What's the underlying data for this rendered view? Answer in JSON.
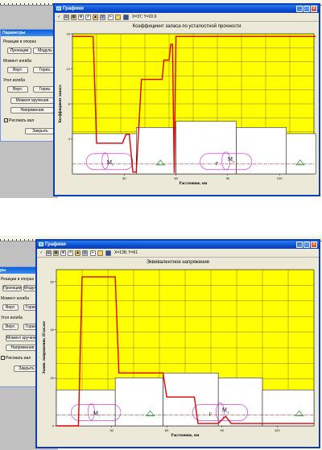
{
  "sidebar_a": {
    "panel_title": "Параметры",
    "group_reactions": "Реакции в опорах",
    "btn_projections": "Проекции",
    "btn_modulus": "Модуль",
    "group_bending_moment": "Момент изгиба",
    "btn_vert": "Верт.",
    "btn_horiz": "Гориз.",
    "group_deflection": "Угол изгиба",
    "btn_torque": "Момент кручения",
    "btn_stress": "Напряжения",
    "checkbox_draw_shaft": "Рисовать вал",
    "btn_close": "Закрыть"
  },
  "sidebar_b": {
    "panel_title": "Параметры",
    "group_reactions": "Реакции в опорах",
    "btn_projections": "Проекции",
    "btn_modulus": "Модуль",
    "group_bending_moment": "Момент изгиба",
    "btn_vert": "Верт.",
    "btn_horiz": "Гориз.",
    "group_deflection": "Угол изгиба",
    "btn_torque": "Момент кручения",
    "btn_stress": "Напряжения",
    "checkbox_draw_shaft": "Рисовать вал",
    "btn_close": "Закрыть"
  },
  "window_a": {
    "title": "Графики",
    "coords": "X=37; Y=20.6",
    "font_button": "F",
    "chart_title": "Коэффициент запаса по усталостной прочности"
  },
  "window_b": {
    "title": "Графики",
    "coords": "X=138; Y=61",
    "font_button": "F",
    "chart_title": "Эквивалентное напряжение"
  },
  "colors": {
    "plot_bg": "#ffff00",
    "curve": "#e00000",
    "shaft_outline": "#000000",
    "annotation": "#d020d0",
    "support": "#2a9a2a"
  },
  "icons": [
    "check-icon",
    "print-icon",
    "save-icon",
    "zoom-icon",
    "grid-icon",
    "chart-icon",
    "axes-icon",
    "font-icon",
    "folder-icon",
    "disk-icon"
  ],
  "chart_data": [
    {
      "type": "line",
      "title": "Коэффициент запаса по усталостной прочности",
      "xlabel": "Расстояние, мм",
      "ylabel": "Коэффициент запаса",
      "xlim": [
        0,
        140
      ],
      "ylim": [
        0,
        16
      ],
      "x_ticks": [
        30,
        60,
        90,
        120
      ],
      "y_ticks": [
        4,
        8,
        12,
        16
      ],
      "tick_labels": {
        "x": [
          "30",
          "60",
          "90",
          "120"
        ],
        "y": [
          "4",
          "8",
          "12",
          "16"
        ]
      },
      "grid": true,
      "series": [
        {
          "x": [
            0,
            12,
            14,
            16,
            20,
            29,
            31,
            33,
            35,
            37,
            40,
            41,
            52,
            53,
            56,
            57,
            58,
            59,
            60,
            141
          ],
          "y": [
            15.7,
            15.7,
            3.5,
            3.5,
            3.5,
            3.5,
            4.5,
            4.5,
            0.2,
            0.2,
            10.8,
            10.8,
            10.8,
            13.0,
            13.0,
            14.8,
            14.8,
            0.1,
            15.7,
            15.7
          ]
        }
      ],
      "annotations": [
        "M",
        "t",
        "F",
        "M",
        "a"
      ]
    },
    {
      "type": "line",
      "title": "Эквивалентное напряжение",
      "xlabel": "Расстояние, мм",
      "ylabel": "Эквив. напряжение, Н/кв.мм",
      "xlim": [
        0,
        140
      ],
      "ylim": [
        0,
        65
      ],
      "x_ticks": [
        30,
        60,
        90,
        120
      ],
      "y_ticks": [
        0,
        20,
        40,
        60
      ],
      "tick_labels": {
        "x": [
          "30",
          "60",
          "90",
          "120"
        ],
        "y": [
          "0",
          "20",
          "40",
          "60"
        ]
      },
      "grid": true,
      "series": [
        {
          "x": [
            0,
            12,
            14,
            32,
            34,
            58,
            60,
            75,
            77,
            88,
            92,
            95,
            140
          ],
          "y": [
            0,
            0,
            62,
            62,
            22,
            22,
            12,
            12,
            1,
            1,
            4,
            1,
            1
          ]
        }
      ],
      "annotations": [
        "M",
        "t",
        "F",
        "M",
        "a"
      ]
    }
  ]
}
